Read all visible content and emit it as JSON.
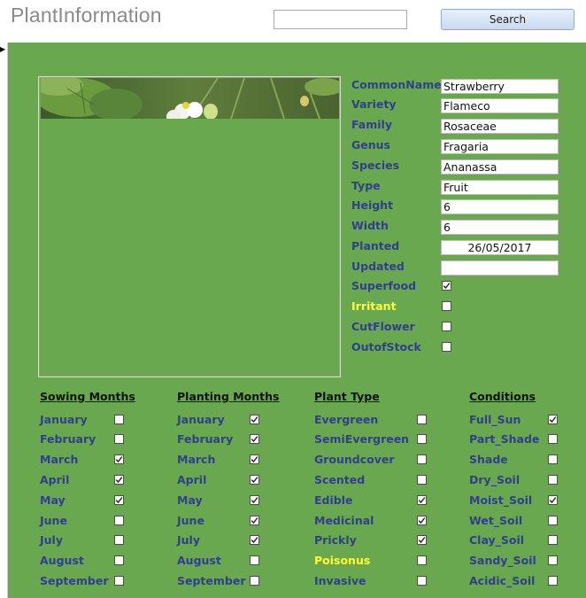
{
  "app": {
    "title": "PlantInformation"
  },
  "search": {
    "value": "",
    "placeholder": "",
    "button_label": "Search"
  },
  "plant": {
    "common_name": {
      "label": "CommonName",
      "value": "Strawberry"
    },
    "variety": {
      "label": "Variety",
      "value": "Flameco"
    },
    "family": {
      "label": "Family",
      "value": "Rosaceae"
    },
    "genus": {
      "label": "Genus",
      "value": "Fragaria"
    },
    "species": {
      "label": "Species",
      "value": "Ananassa"
    },
    "type": {
      "label": "Type",
      "value": "Fruit"
    },
    "height": {
      "label": "Height",
      "value": "6"
    },
    "width": {
      "label": "Width",
      "value": "6"
    },
    "planted": {
      "label": "Planted",
      "value": "26/05/2017"
    },
    "updated": {
      "label": "Updated",
      "value": ""
    },
    "flags": [
      {
        "label": "Superfood",
        "checked": true,
        "highlight": false
      },
      {
        "label": "Irritant",
        "checked": false,
        "highlight": true
      },
      {
        "label": "CutFlower",
        "checked": false,
        "highlight": false
      },
      {
        "label": "OutofStock",
        "checked": false,
        "highlight": false
      }
    ]
  },
  "groups": [
    {
      "title": "Sowing Months",
      "items": [
        {
          "label": "January",
          "checked": false,
          "highlight": false
        },
        {
          "label": "February",
          "checked": false,
          "highlight": false
        },
        {
          "label": "March",
          "checked": true,
          "highlight": false
        },
        {
          "label": "April",
          "checked": true,
          "highlight": false
        },
        {
          "label": "May",
          "checked": true,
          "highlight": false
        },
        {
          "label": "June",
          "checked": false,
          "highlight": false
        },
        {
          "label": "July",
          "checked": false,
          "highlight": false
        },
        {
          "label": "August",
          "checked": false,
          "highlight": false
        },
        {
          "label": "September",
          "checked": false,
          "highlight": false
        }
      ]
    },
    {
      "title": "Planting Months",
      "items": [
        {
          "label": "January",
          "checked": true,
          "highlight": false
        },
        {
          "label": "February",
          "checked": true,
          "highlight": false
        },
        {
          "label": "March",
          "checked": true,
          "highlight": false
        },
        {
          "label": "April",
          "checked": true,
          "highlight": false
        },
        {
          "label": "May",
          "checked": true,
          "highlight": false
        },
        {
          "label": "June",
          "checked": true,
          "highlight": false
        },
        {
          "label": "July",
          "checked": true,
          "highlight": false
        },
        {
          "label": "August",
          "checked": false,
          "highlight": false
        },
        {
          "label": "September",
          "checked": false,
          "highlight": false
        }
      ]
    },
    {
      "title": "Plant Type",
      "items": [
        {
          "label": "Evergreen",
          "checked": false,
          "highlight": false
        },
        {
          "label": "SemiEvergreen",
          "checked": false,
          "highlight": false
        },
        {
          "label": "Groundcover",
          "checked": false,
          "highlight": false
        },
        {
          "label": "Scented",
          "checked": false,
          "highlight": false
        },
        {
          "label": "Edible",
          "checked": true,
          "highlight": false
        },
        {
          "label": "Medicinal",
          "checked": true,
          "highlight": false
        },
        {
          "label": "Prickly",
          "checked": true,
          "highlight": false
        },
        {
          "label": "Poisonus",
          "checked": false,
          "highlight": true
        },
        {
          "label": "Invasive",
          "checked": false,
          "highlight": false
        }
      ]
    },
    {
      "title": "Conditions",
      "items": [
        {
          "label": "Full_Sun",
          "checked": true,
          "highlight": false
        },
        {
          "label": "Part_Shade",
          "checked": false,
          "highlight": false
        },
        {
          "label": "Shade",
          "checked": false,
          "highlight": false
        },
        {
          "label": "Dry_Soil",
          "checked": false,
          "highlight": false
        },
        {
          "label": "Moist_Soil",
          "checked": true,
          "highlight": false
        },
        {
          "label": "Wet_Soil",
          "checked": false,
          "highlight": false
        },
        {
          "label": "Clay_Soil",
          "checked": false,
          "highlight": false
        },
        {
          "label": "Sandy_Soil",
          "checked": false,
          "highlight": false
        },
        {
          "label": "Acidic_Soil",
          "checked": false,
          "highlight": false
        }
      ]
    }
  ],
  "colors": {
    "form_bg": "#6aa84f",
    "label": "#2f3f8f",
    "warn_label": "#ffff33"
  },
  "icons": {
    "record_selector": "triangle-right-icon",
    "checkmark": "checkmark-icon"
  }
}
